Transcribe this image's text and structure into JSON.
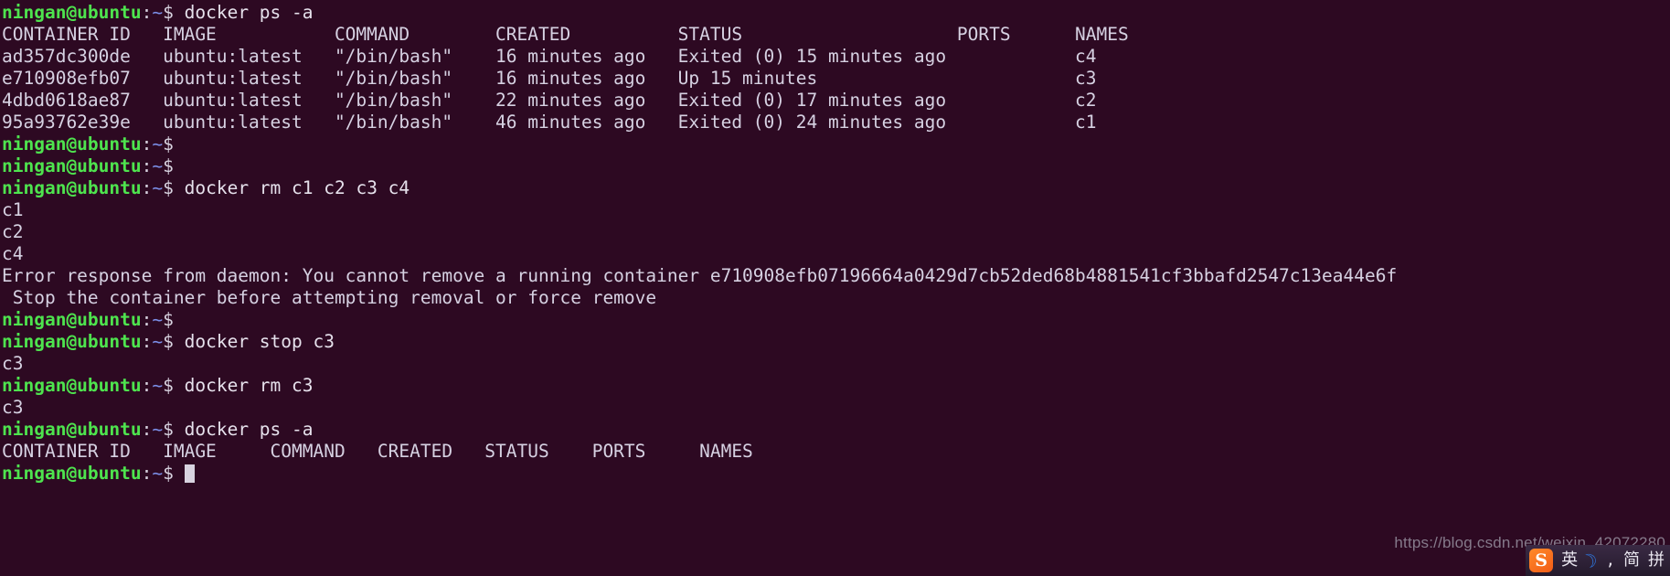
{
  "terminal": {
    "prompt": {
      "user_host": "ningan@ubuntu",
      "colon": ":",
      "path": "~",
      "dollar": "$"
    },
    "colors": {
      "background": "#2d0922",
      "prompt_user": "#4ee44e",
      "prompt_path": "#7b8fe8",
      "foreground": "#d8d3e0"
    },
    "lines": [
      {
        "type": "command",
        "text": " docker ps -a"
      },
      {
        "type": "output",
        "text": "CONTAINER ID   IMAGE           COMMAND        CREATED          STATUS                    PORTS      NAMES"
      },
      {
        "type": "output",
        "text": "ad357dc300de   ubuntu:latest   \"/bin/bash\"    16 minutes ago   Exited (0) 15 minutes ago            c4"
      },
      {
        "type": "output",
        "text": "e710908efb07   ubuntu:latest   \"/bin/bash\"    16 minutes ago   Up 15 minutes                        c3"
      },
      {
        "type": "output",
        "text": "4dbd0618ae87   ubuntu:latest   \"/bin/bash\"    22 minutes ago   Exited (0) 17 minutes ago            c2"
      },
      {
        "type": "output",
        "text": "95a93762e39e   ubuntu:latest   \"/bin/bash\"    46 minutes ago   Exited (0) 24 minutes ago            c1"
      },
      {
        "type": "command",
        "text": ""
      },
      {
        "type": "command",
        "text": ""
      },
      {
        "type": "command",
        "text": " docker rm c1 c2 c3 c4"
      },
      {
        "type": "output",
        "text": "c1"
      },
      {
        "type": "output",
        "text": "c2"
      },
      {
        "type": "output",
        "text": "c4"
      },
      {
        "type": "output",
        "text": "Error response from daemon: You cannot remove a running container e710908efb07196664a0429d7cb52ded68b4881541cf3bbafd2547c13ea44e6f"
      },
      {
        "type": "output",
        "text": " Stop the container before attempting removal or force remove"
      },
      {
        "type": "command",
        "text": ""
      },
      {
        "type": "command",
        "text": " docker stop c3"
      },
      {
        "type": "output",
        "text": "c3"
      },
      {
        "type": "command",
        "text": " docker rm c3"
      },
      {
        "type": "output",
        "text": "c3"
      },
      {
        "type": "command",
        "text": " docker ps -a"
      },
      {
        "type": "output",
        "text": "CONTAINER ID   IMAGE     COMMAND   CREATED   STATUS    PORTS     NAMES"
      },
      {
        "type": "cursor",
        "text": " "
      }
    ]
  },
  "watermark": {
    "url": "https://blog.csdn.net/weixin_42072280"
  },
  "ime": {
    "logo": "S",
    "mode_label": "英",
    "moon": "☽",
    "comma": ",",
    "simplified_label": "简",
    "pinyin_label": "拼"
  }
}
